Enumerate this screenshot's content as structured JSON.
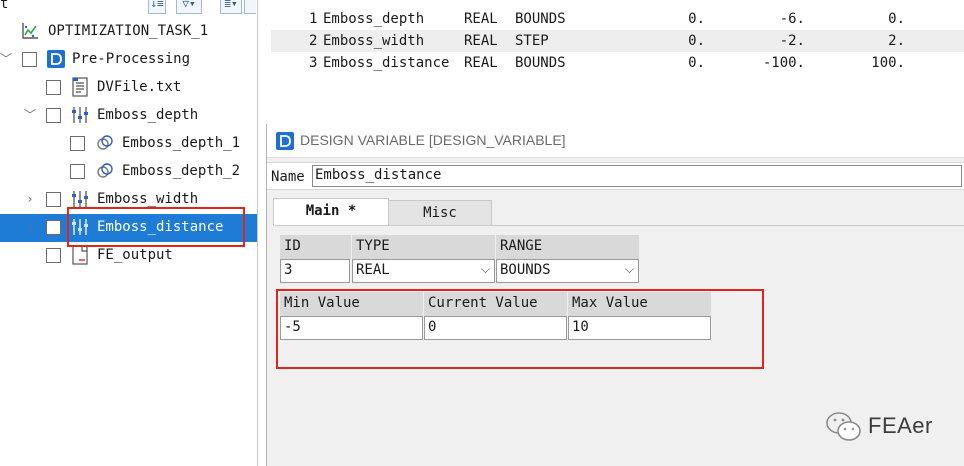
{
  "tree": {
    "toolbar_label": "t",
    "root_label": "OPTIMIZATION_TASK_1",
    "items": [
      {
        "label": "Pre-Processing"
      },
      {
        "label": "DVFile.txt"
      },
      {
        "label": "Emboss_depth"
      },
      {
        "label": "Emboss_depth_1"
      },
      {
        "label": "Emboss_depth_2"
      },
      {
        "label": "Emboss_width"
      },
      {
        "label": "Emboss_distance"
      },
      {
        "label": "FE_output"
      }
    ]
  },
  "var_table": {
    "rows": [
      {
        "index": "1",
        "name": "Emboss_depth",
        "type": "REAL",
        "range": "BOUNDS",
        "min": "0.",
        "current": "-6.",
        "max": "0."
      },
      {
        "index": "2",
        "name": "Emboss_width",
        "type": "REAL",
        "range": "STEP",
        "min": "0.",
        "current": "-2.",
        "max": "2."
      },
      {
        "index": "3",
        "name": "Emboss_distance",
        "type": "REAL",
        "range": "BOUNDS",
        "min": "0.",
        "current": "-100.",
        "max": "100."
      }
    ]
  },
  "dialog": {
    "title": "DESIGN VARIABLE [DESIGN_VARIABLE]",
    "name_label": "Name",
    "name_value": "Emboss_distance",
    "tabs": [
      {
        "label": "Main *"
      },
      {
        "label": "Misc"
      }
    ],
    "id_header": "ID",
    "type_header": "TYPE",
    "range_header": "RANGE",
    "id_value": "3",
    "type_value": "REAL",
    "range_value": "BOUNDS",
    "min_header": "Min Value",
    "current_header": "Current Value",
    "max_header": "Max Value",
    "min_value": "-5",
    "current_value": "0",
    "max_value": "10"
  },
  "watermark": {
    "text": "FEAer"
  },
  "colors": {
    "selection": "#1e7bd6",
    "highlight_frame": "#e1251b"
  }
}
